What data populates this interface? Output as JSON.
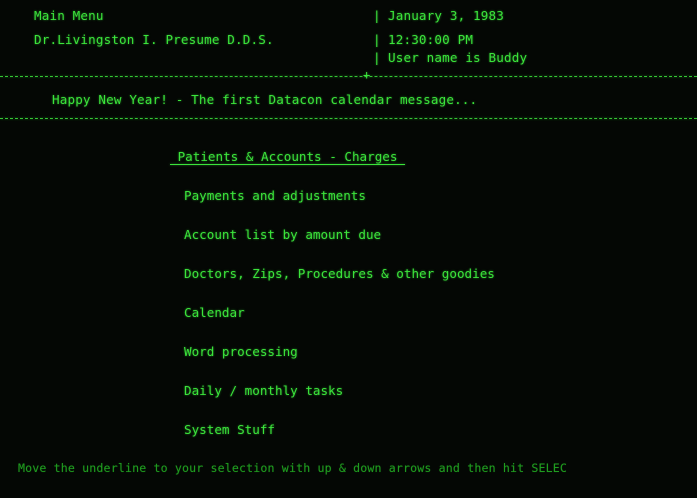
{
  "header": {
    "screen_title": "Main Menu",
    "practice_name": "Dr.Livingston I. Presume D.D.S.",
    "date": "January 3, 1983",
    "time": "12:30:00 PM",
    "user_line": "User name is Buddy",
    "separator": "|",
    "junction": "+"
  },
  "message": {
    "text": "Happy New Year! - The first Datacon calendar message..."
  },
  "menu": {
    "selected_index": 0,
    "items": [
      {
        "label": " Patients & Accounts - Charges "
      },
      {
        "label": "Payments and adjustments"
      },
      {
        "label": "Account list by amount due"
      },
      {
        "label": "Doctors, Zips, Procedures & other goodies"
      },
      {
        "label": "Calendar"
      },
      {
        "label": "Word processing"
      },
      {
        "label": "Daily / monthly tasks"
      },
      {
        "label": "System Stuff"
      }
    ]
  },
  "footer": {
    "instructions": "Move the underline to your selection with up & down arrows and then hit SELEC"
  },
  "colors": {
    "background": "#040704",
    "phosphor_green": "#3be43b",
    "dim_green": "#1f9c1f"
  }
}
